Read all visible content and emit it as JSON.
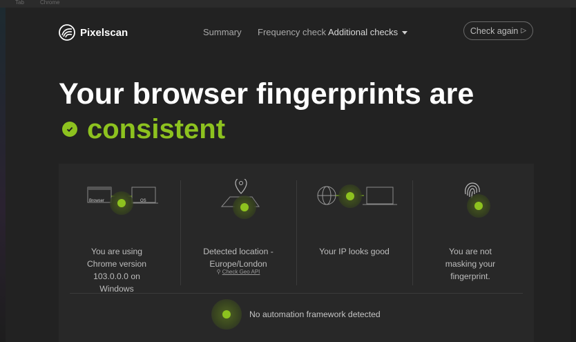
{
  "browser_chrome": {
    "fragments": [
      "Tab",
      "Chrome"
    ]
  },
  "nav": {
    "brand": "Pixelscan",
    "links": [
      {
        "label": "Summary"
      },
      {
        "label": "Frequency check"
      },
      {
        "label": "Additional checks"
      }
    ],
    "check_again": "Check again"
  },
  "headline": {
    "line1": "Your browser fingerprints are",
    "status_word": "consistent"
  },
  "checks": [
    {
      "illustration_labels": [
        "Browser",
        "OS"
      ],
      "text": "You are using Chrome version 103.0.0.0 on Windows"
    },
    {
      "text": "Detected location - Europe/London",
      "link": "Check Geo API"
    },
    {
      "text": "Your IP looks good"
    },
    {
      "text": "You are not masking your fingerprint."
    }
  ],
  "automation": {
    "text": "No automation framework detected"
  },
  "colors": {
    "accent": "#8dc21f",
    "background": "#222222",
    "panel": "#282828"
  },
  "icons": [
    "pixelscan-logo-icon",
    "caret-down-icon",
    "play-icon",
    "check-circle-icon",
    "location-pin-icon",
    "globe-icon",
    "laptop-icon",
    "fingerprint-icon"
  ]
}
